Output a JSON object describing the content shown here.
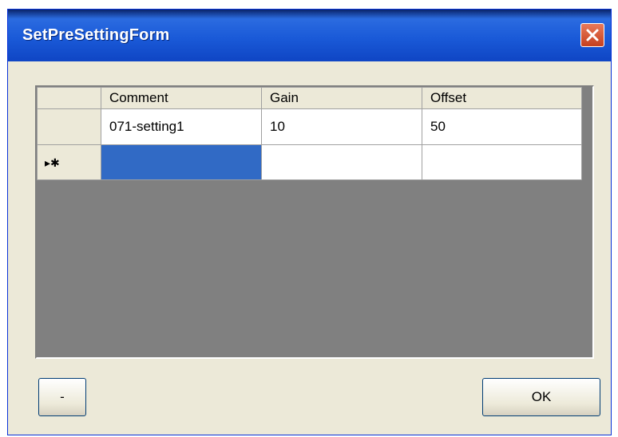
{
  "window": {
    "title": "SetPreSettingForm"
  },
  "grid": {
    "columns": [
      "Comment",
      "Gain",
      "Offset"
    ],
    "rows": [
      {
        "comment": "071-setting1",
        "gain": "10",
        "offset": "50"
      }
    ],
    "new_row_marker": "▸✱",
    "selection_color": "#316ac5"
  },
  "buttons": {
    "minus_label": "-",
    "ok_label": "OK"
  },
  "icons": {
    "close": "close-icon"
  },
  "colors": {
    "titlebar": "#1a5ad8",
    "window_bg": "#ece9d8",
    "grid_bg": "#808080",
    "close_button": "#d8552f"
  }
}
